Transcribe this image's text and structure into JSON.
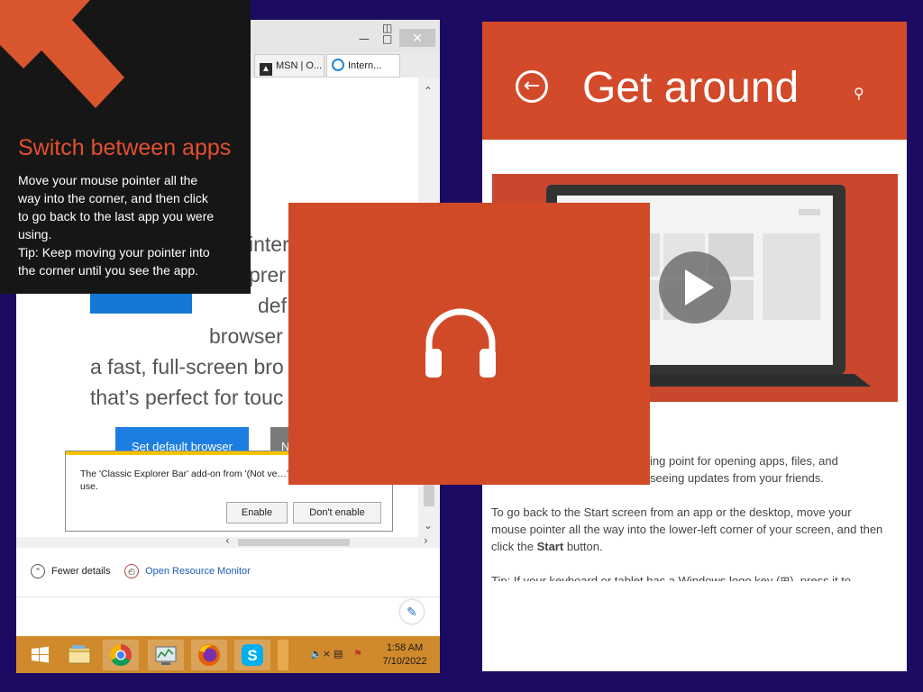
{
  "browser_window": {
    "tabs": [
      {
        "label": "MSN | O..."
      },
      {
        "label": "Intern..."
      }
    ],
    "hero_lines": [
      "inter",
      "prer",
      "def",
      "browser",
      "a fast, full-screen bro",
      "that’s perfect for touc"
    ],
    "set_default_label": "Set default browser",
    "grey_button_label": "N",
    "notification": {
      "message": "The 'Classic Explorer Bar' add-on from '(Not ve…' is ready for use.",
      "enable_label": "Enable",
      "dont_enable_label": "Don't enable"
    },
    "fewer_details_label": "Fewer details",
    "resource_monitor_label": "Open Resource Monitor"
  },
  "taskbar": {
    "icons": [
      "windows-start-icon",
      "file-explorer-icon",
      "chrome-icon",
      "task-manager-icon",
      "firefox-icon",
      "skype-icon"
    ],
    "time": "1:58 AM",
    "date": "7/10/2022"
  },
  "tooltip": {
    "title": "Switch between apps",
    "body_lines": [
      "Move your mouse pointer all the",
      "way into the corner, and then click",
      "to go back to the last app you were",
      "using.",
      "Tip: Keep moving your pointer into",
      "the corner until you see the app."
    ]
  },
  "help": {
    "title": "Get around",
    "paragraph_1": "ing point for opening apps, files, and folders, watching … seeing updates from your friends.",
    "para1_line1": "ing point for opening apps, files, and",
    "para1_line2": "seeing updates from your friends.",
    "para2_part1": "To go back to the Start screen from an app or the desktop, move your mouse pointer all the way into the lower-left corner of your screen, and then click the ",
    "para2_bold": "Start",
    "para2_part2": " button.",
    "para3": "Tip: If your keyboard or tablet has a Windows logo key (⊞), press it to"
  },
  "colors": {
    "background": "#1c0a63",
    "accent_orange": "#d14a27",
    "taskbar": "#d08a2c",
    "tooltip_bg": "#161616",
    "link_blue": "#1a5fb4"
  }
}
